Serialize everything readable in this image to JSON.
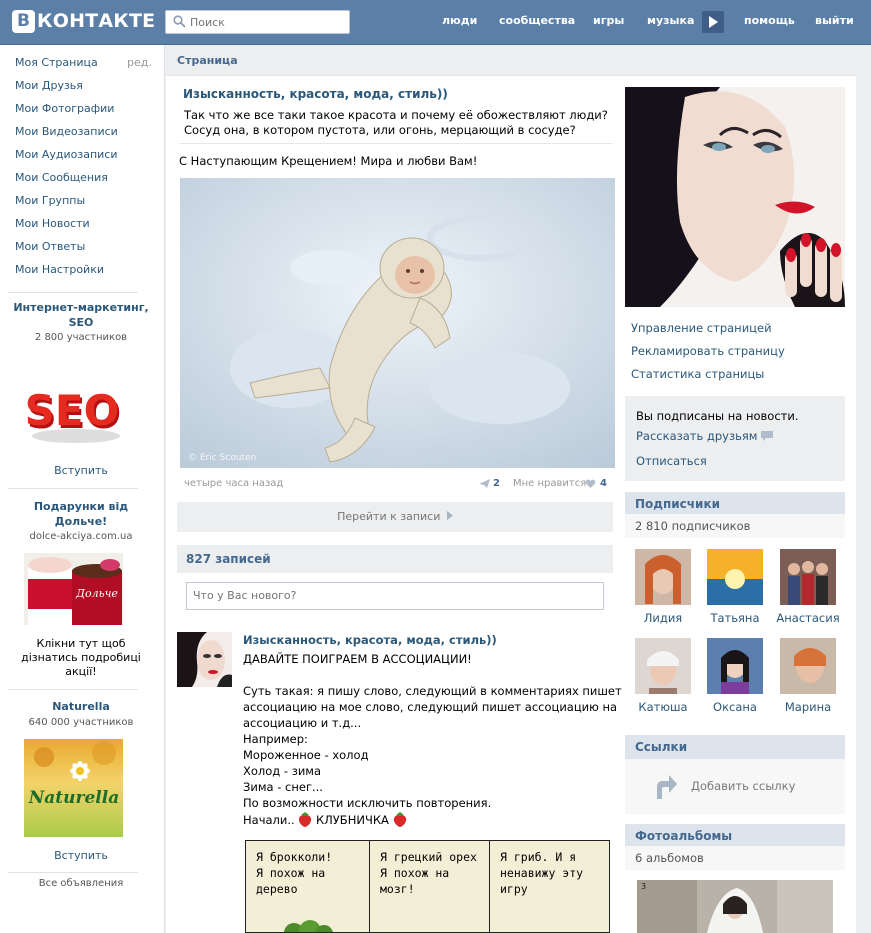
{
  "header": {
    "logo_b": "B",
    "logo_text": "КОНТАКТЕ",
    "search_placeholder": "Поиск",
    "nav": [
      "люди",
      "сообщества",
      "игры",
      "музыка",
      "помощь",
      "выйти"
    ]
  },
  "left_nav": {
    "items": [
      "Моя Страница",
      "Мои Друзья",
      "Мои Фотографии",
      "Мои Видеозаписи",
      "Мои Аудиозаписи",
      "Мои Сообщения",
      "Мои Группы",
      "Мои Новости",
      "Мои Ответы",
      "Мои Настройки"
    ],
    "edit_label": "ред."
  },
  "ads": [
    {
      "title": "Интернет-маркетинг, SEO",
      "subtitle": "2 800 участников",
      "image_text": "SEO",
      "button": "Вступить"
    },
    {
      "title": "Подарунки від Дольче!",
      "subtitle": "dolce-akciya.com.ua",
      "image_text": "Дольче",
      "description": "Клікни тут щоб дізнатись подробиці акції!"
    },
    {
      "title": "Naturella",
      "subtitle": "640 000 участников",
      "image_text": "Naturella",
      "button": "Вступить"
    }
  ],
  "all_ads_label": "Все объявления",
  "page": {
    "header_label": "Страница",
    "title": "Изысканность, красота, мода, стиль))",
    "status": "Так что же все таки такое красота и почему её обожествляют люди? Сосуд она, в котором пустота, или огонь, мерцающий в сосуде?",
    "post_text": "С Наступающим Крещением! Мира и любви Вам!",
    "photo_credit": "© Eric Scouten",
    "post_time": "четыре часа назад",
    "share_count": "2",
    "like_label": "Мне нравится",
    "like_count": "4",
    "goto_label": "Перейти к записи",
    "records_count": "827 записей",
    "new_post_placeholder": "Что у Вас нового?"
  },
  "wall_post": {
    "author": "Изысканность, красота, мода, стиль))",
    "lines": [
      "ДАВАЙТЕ ПОИГРАЕМ В АССОЦИАЦИИ!",
      "",
      "Суть такая: я пишу слово, следующий в комментариях пишет",
      "ассоциацию на мое слово, следующий пишет ассоциацию на",
      "ассоциацию и т.д...",
      "Например:",
      "Мороженное - холод",
      "Холод - зима",
      "Зима - снег...",
      "По возможности исключить повторения."
    ],
    "last_line": "Начали..",
    "last_word": "КЛУБНИЧКА",
    "comic_panels": [
      "Я брокколи!\nЯ похож на\nдерево",
      "Я грецкий орех\nЯ похож на\nмозг!",
      "Я гриб. И я\nненавижу эту\nигру"
    ]
  },
  "right": {
    "links": [
      "Управление страницей",
      "Рекламировать страницу",
      "Статистика страницы"
    ],
    "subscribed_text": "Вы подписаны на новости.",
    "tell_friends": "Рассказать друзьям",
    "unsubscribe": "Отписаться",
    "subscribers_header": "Подписчики",
    "subscribers_count": "2 810 подписчиков",
    "subscribers": [
      "Лидия",
      "Татьяна",
      "Анастасия",
      "Катюша",
      "Оксана",
      "Марина"
    ],
    "links_header": "Ссылки",
    "add_link": "Добавить ссылку",
    "albums_header": "Фотоальбомы",
    "albums_count": "6 альбомов",
    "album_badge": "3"
  },
  "colors": {
    "header_bg": "#5b7fa6",
    "link": "#2b587a",
    "section_title": "#45688e",
    "gray_bg": "#edeef0",
    "lips_red": "#d3132a"
  }
}
